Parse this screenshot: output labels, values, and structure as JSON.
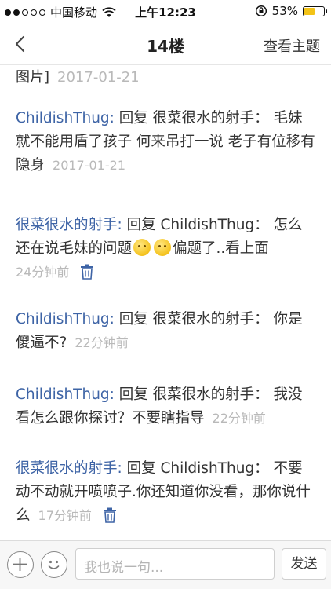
{
  "status_bar": {
    "carrier": "中国移动",
    "time": "上午12:23",
    "battery_percent": "53%",
    "battery_level": 0.53,
    "colors": {
      "battery_fill": "#f3c317"
    }
  },
  "nav": {
    "title": "14楼",
    "right_label": "查看主题",
    "back_icon": "chevron-left-icon"
  },
  "top_fragment": {
    "text": "图片]",
    "time": "2017-01-21"
  },
  "replies": [
    {
      "author": "ChildishThug:",
      "body": " 回复 很菜很水的射手： 毛妹就不能用盾了孩子 何来吊打一说 老子有位移有隐身",
      "time": "2017-01-21"
    },
    {
      "author": "很菜很水的射手:",
      "body_before_emoji": " 回复 ChildishThug： 怎么还在说毛妹的问题",
      "body_after_emoji": "偏题了..看上面",
      "emoji_icon": "thinking-face-emoji",
      "time": "24分钟前",
      "delete_icon": "trash-icon"
    },
    {
      "author": "ChildishThug:",
      "body": " 回复 很菜很水的射手： 你是傻逼不?",
      "time": "22分钟前"
    },
    {
      "author": "ChildishThug:",
      "body": " 回复 很菜很水的射手： 我没看怎么跟你探讨？不要瞎指导",
      "time": "22分钟前"
    },
    {
      "author": "很菜很水的射手:",
      "body": " 回复 ChildishThug： 不要动不动就开喷喷子.你还知道你没看，那你说什么",
      "time": "17分钟前",
      "delete_icon": "trash-icon"
    }
  ],
  "bottom_bar": {
    "input_placeholder": "我也说一句...",
    "send_label": "发送",
    "plus_icon": "plus-icon",
    "emoji_icon": "smiley-icon"
  },
  "colors": {
    "author": "#3e64a6",
    "timestamp": "#b9b9b9",
    "icon_blue": "#3e64a6"
  }
}
